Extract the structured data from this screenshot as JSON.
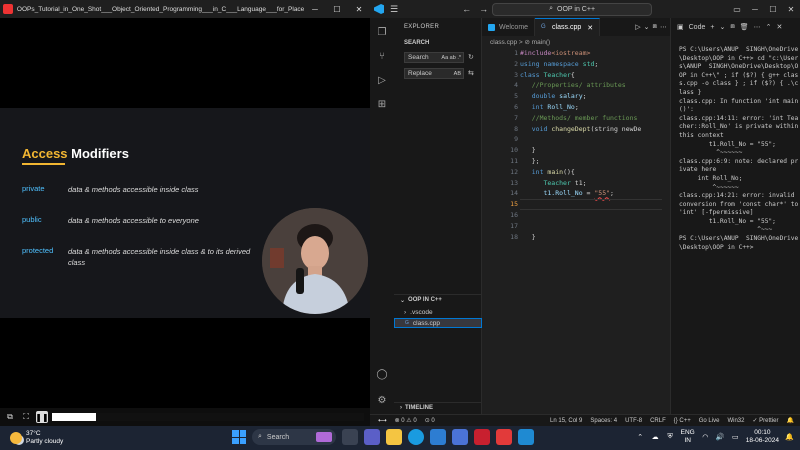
{
  "player": {
    "title": "OOPs_Tutorial_in_One_Shot___Object_Oriented_Programming___in_C___Language___for_Placement_I...",
    "slide": {
      "title_highlight": "Access",
      "title_rest": " Modifiers",
      "rows": [
        {
          "key": "private",
          "value": "data & methods accessible inside class"
        },
        {
          "key": "public",
          "value": "data & methods accessible to everyone"
        },
        {
          "key": "protected",
          "value": "data & methods accessible inside class & to its derived class"
        }
      ]
    },
    "progress": 0.13
  },
  "vscode": {
    "command_center": "OOP in C++",
    "sidebar": {
      "header": "EXPLORER",
      "search_section": "SEARCH",
      "search_placeholder": "Search",
      "search_opts": "Aa ab .*",
      "replace_placeholder": "Replace",
      "replace_opts": "AB",
      "folder": "OOP IN C++",
      "items": [
        ".vscode",
        "class.cpp"
      ],
      "timeline": "TIMELINE"
    },
    "tabs": [
      {
        "label": "Welcome",
        "active": false
      },
      {
        "label": "class.cpp",
        "active": true
      }
    ],
    "breadcrumb": "class.cpp > ⊘ main()",
    "code_lines": [
      {
        "n": "1"
      },
      {
        "n": "2"
      },
      {
        "n": "3"
      },
      {
        "n": "4"
      },
      {
        "n": "5"
      },
      {
        "n": "6"
      },
      {
        "n": "7"
      },
      {
        "n": "8"
      },
      {
        "n": "9"
      },
      {
        "n": "10"
      },
      {
        "n": "11"
      },
      {
        "n": "12"
      },
      {
        "n": "13"
      },
      {
        "n": "14"
      },
      {
        "n": "15"
      },
      {
        "n": "16"
      },
      {
        "n": "17"
      },
      {
        "n": "18"
      }
    ],
    "code": {
      "l1_pp": "#include",
      "l1_st": "<iostream>",
      "l2_kw1": "using",
      "l2_kw2": "namespace",
      "l2_ty": "std",
      "l2_end": ";",
      "l3_kw": "class",
      "l3_ty": "Teacher",
      "l3_end": "{",
      "l4_cm": "//Properties/ attributes",
      "l5_kw": "double",
      "l5_var": "salary",
      "l5_end": ";",
      "l6_kw": "int",
      "l6_var": "Roll_No",
      "l6_end": ";",
      "l7_cm": "//Methods/ member functions",
      "l8_kw": "void",
      "l8_fn": "changeDept",
      "l8_end": "(string newDe",
      "l10": "}",
      "l11": "};",
      "l12_kw": "int",
      "l12_fn": "main",
      "l12_end": "(){",
      "l13_ty": "Teacher",
      "l13_end": " t1;",
      "l14_var": "t1.Roll_No",
      "l14_op": " = ",
      "l14_st": "\"55\"",
      "l14_end": ";",
      "l18": "}"
    },
    "terminal": {
      "label": "Code",
      "output": "PS C:\\Users\\ANUP  SINGH\\OneDrive\\Desktop\\OOP in C++> cd \"c:\\Users\\ANUP  SINGH\\OneDrive\\Desktop\\OOP in C++\\\" ; if ($?) { g++ class.cpp -o class } ; if ($?) { .\\class }\nclass.cpp: In function 'int main()':\nclass.cpp:14:11: error: 'int Teacher::Roll_No' is private within this context\n        t1.Roll_No = \"55\";\n          ^~~~~~~\nclass.cpp:6:9: note: declared private here\n     int Roll_No;\n         ^~~~~~~\nclass.cpp:14:21: error: invalid conversion from 'const char*' to 'int' [-fpermissive]\n        t1.Roll_No = \"55\";\n                     ^~~~\nPS C:\\Users\\ANUP  SINGH\\OneDrive\\Desktop\\OOP in C++>"
    },
    "status": {
      "errors": "⊗ 0 ⚠ 0",
      "ports": "⊙ 0",
      "position": "Ln 15, Col 9",
      "spaces": "Spaces: 4",
      "encoding": "UTF-8",
      "eol": "CRLF",
      "lang": "{} C++",
      "golive": "Go Live",
      "platform": "Win32",
      "prettier": "✓ Prettier"
    }
  },
  "taskbar": {
    "temp": "37°C",
    "condition": "Partly cloudy",
    "search": "Search",
    "lang1": "ENG",
    "lang2": "IN",
    "time": "00:10",
    "date": "18-06-2024"
  }
}
